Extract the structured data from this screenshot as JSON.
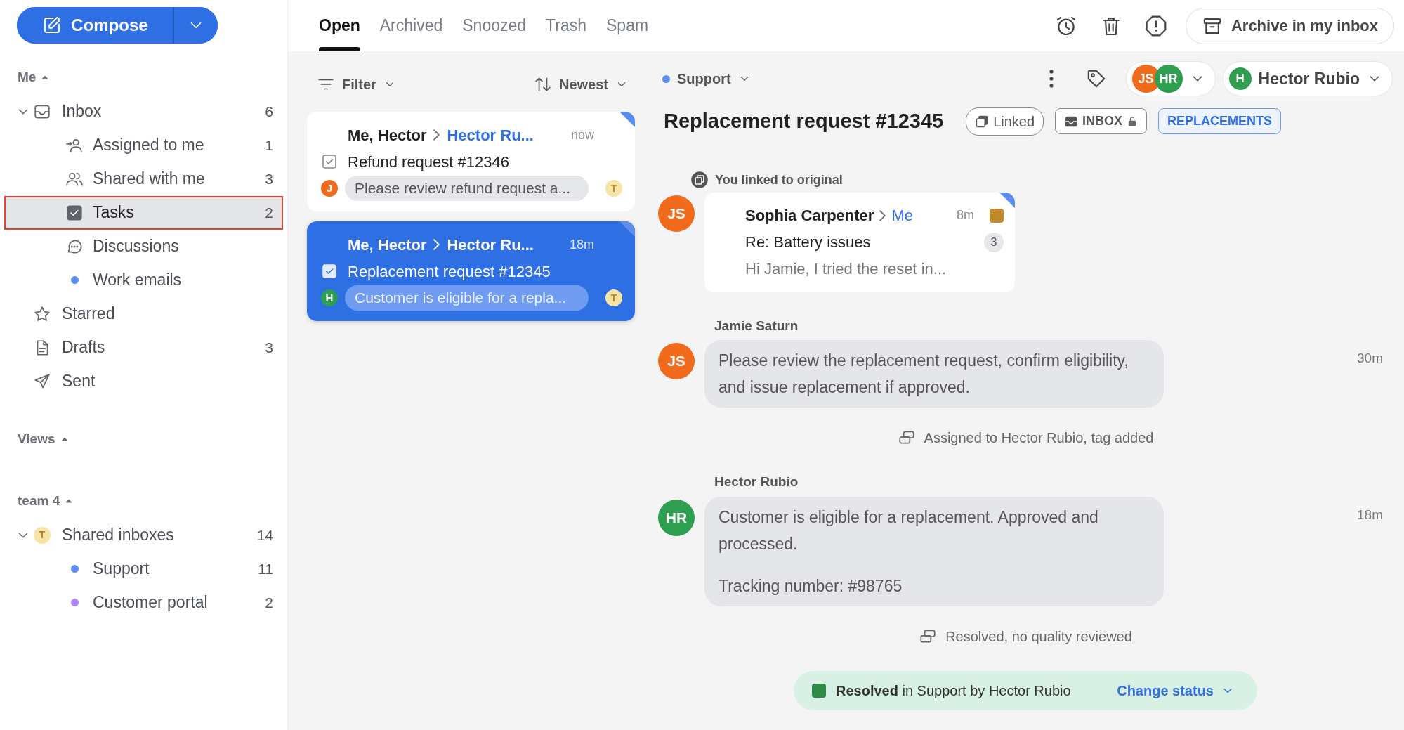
{
  "compose": {
    "label": "Compose"
  },
  "sidebar": {
    "sections": [
      {
        "title": "Me",
        "expanded": true,
        "items": [
          {
            "kind": "inbox",
            "label": "Inbox",
            "count": "6",
            "expanded": true,
            "selected": false,
            "children": [
              {
                "kind": "assigned",
                "label": "Assigned to me",
                "count": "1",
                "selected": false
              },
              {
                "kind": "shared",
                "label": "Shared with me",
                "count": "3",
                "selected": false
              },
              {
                "kind": "tasks",
                "label": "Tasks",
                "count": "2",
                "selected": true
              },
              {
                "kind": "discussions",
                "label": "Discussions",
                "selected": false
              },
              {
                "kind": "label",
                "label": "Work emails",
                "color": "#5b8def",
                "selected": false
              }
            ]
          },
          {
            "kind": "starred",
            "label": "Starred",
            "selected": false
          },
          {
            "kind": "drafts",
            "label": "Drafts",
            "count": "3",
            "selected": false
          },
          {
            "kind": "sent",
            "label": "Sent",
            "selected": false
          }
        ]
      },
      {
        "title": "Views",
        "expanded": true
      },
      {
        "title": "team 4",
        "expanded": true,
        "items": [
          {
            "kind": "team",
            "label": "Shared inboxes",
            "badge": "T",
            "count": "14",
            "expanded": true,
            "selected": false,
            "children": [
              {
                "kind": "label",
                "label": "Support",
                "count": "11",
                "color": "#5b8def",
                "selected": false
              },
              {
                "kind": "label",
                "label": "Customer portal",
                "count": "2",
                "color": "#b084f5",
                "selected": false
              }
            ]
          }
        ]
      }
    ]
  },
  "tabs": [
    {
      "label": "Open",
      "selected": true
    },
    {
      "label": "Archived",
      "selected": false
    },
    {
      "label": "Snoozed",
      "selected": false
    },
    {
      "label": "Trash",
      "selected": false
    },
    {
      "label": "Spam",
      "selected": false
    }
  ],
  "toolbar": {
    "archive_label": "Archive in my inbox"
  },
  "list": {
    "filter": "Filter",
    "sort": "Newest",
    "conversations": [
      {
        "participants": "Me, Hector",
        "recipient": "Hector Ru...",
        "time": "now",
        "subject": "Refund request #12346",
        "avatar": {
          "initials": "J",
          "color": "#f26a1b"
        },
        "preview": "Please review refund request a...",
        "tag": "T",
        "unread": true,
        "selected": false
      },
      {
        "participants": "Me, Hector",
        "recipient": "Hector Ru...",
        "time": "18m",
        "subject": "Replacement request #12345",
        "avatar": {
          "initials": "H",
          "color": "#2e9e4f"
        },
        "preview": "Customer is eligible for a repla...",
        "tag": "T",
        "unread": true,
        "selected": true
      }
    ]
  },
  "conversation": {
    "inbox": {
      "label": "Support",
      "color": "#5b8def"
    },
    "followers": [
      {
        "initials": "JS",
        "color": "#f26a1b"
      },
      {
        "initials": "HR",
        "color": "#2e9e4f"
      }
    ],
    "assignee": {
      "initial": "H",
      "name": "Hector Rubio",
      "color": "#2e9e4f"
    },
    "title": "Replacement request #12345",
    "tags": [
      {
        "kind": "linked",
        "label": "Linked"
      },
      {
        "kind": "inbox",
        "label": "INBOX"
      },
      {
        "kind": "label",
        "label": "REPLACEMENTS"
      }
    ],
    "timeline": [
      {
        "kind": "linked",
        "caption": "You linked to original",
        "avatar": {
          "initials": "JS",
          "color": "#f26a1b"
        },
        "from": "Sophia Carpenter",
        "to": "Me",
        "time": "8m",
        "tag": {
          "color": "#c08a2a"
        },
        "subject": "Re: Battery issues",
        "count": "3",
        "preview": "Hi Jamie, I tried the reset in..."
      },
      {
        "kind": "comment",
        "author": "Jamie Saturn",
        "avatar": {
          "initials": "JS",
          "color": "#f26a1b"
        },
        "paragraphs": [
          "Please review the replacement request, confirm eligibility, and issue replacement if approved."
        ],
        "time": "30m"
      },
      {
        "kind": "event",
        "text": "Assigned to Hector Rubio, tag added"
      },
      {
        "kind": "comment",
        "author": "Hector Rubio",
        "avatar": {
          "initials": "HR",
          "color": "#2e9e4f"
        },
        "paragraphs": [
          "Customer is eligible for a replacement. Approved and processed.",
          "Tracking number: #98765"
        ],
        "time": "18m"
      },
      {
        "kind": "event",
        "text": "Resolved, no quality reviewed"
      }
    ],
    "status": {
      "text": "**Resolved** in Support by Hector Rubio",
      "color": "#2e8b45",
      "action": "Change status"
    }
  }
}
